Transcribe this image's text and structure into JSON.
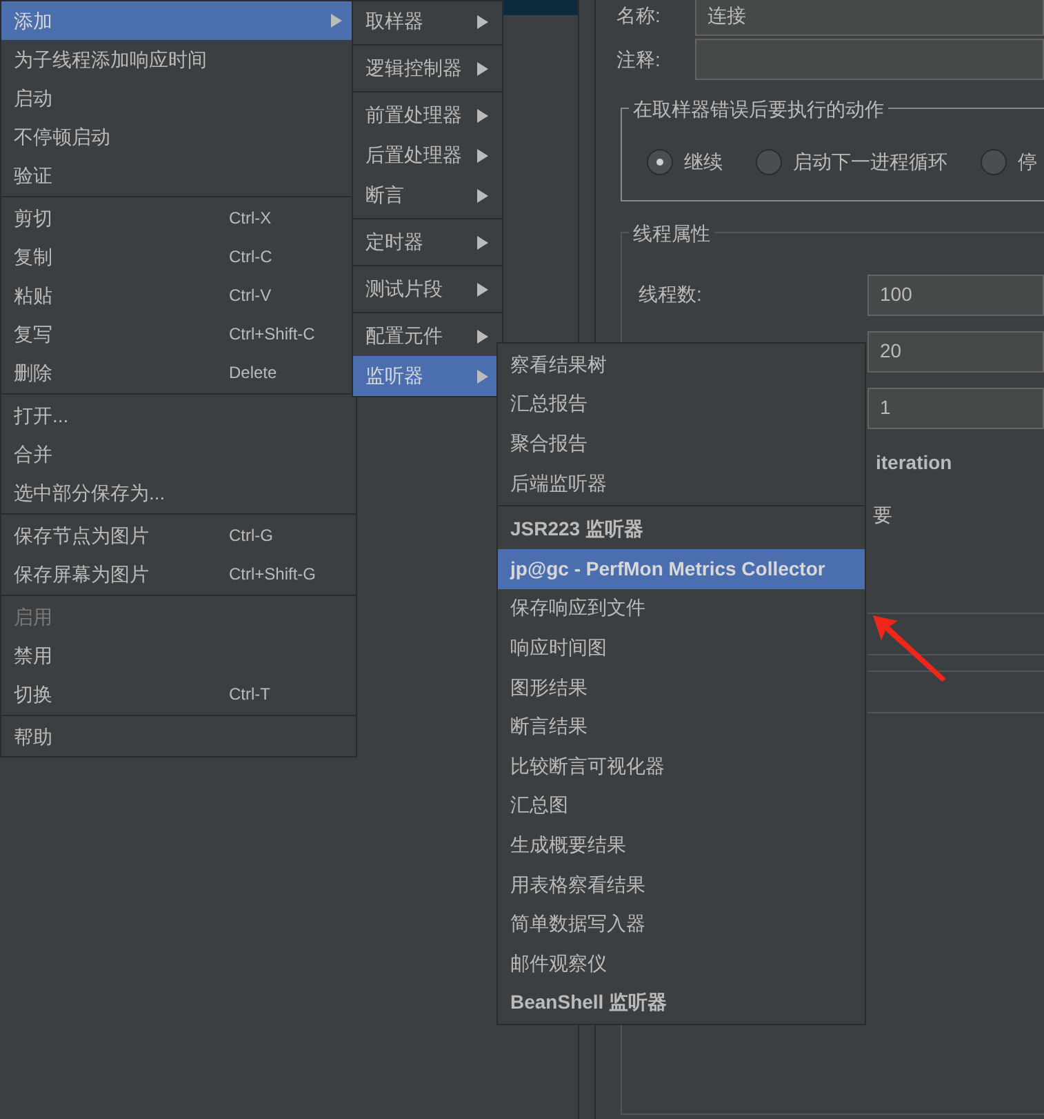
{
  "form": {
    "name_label": "名称:",
    "name_value": "连接",
    "comment_label": "注释:",
    "error_group": {
      "title": "在取样器错误后要执行的动作",
      "options": [
        {
          "label": "继续",
          "selected": true
        },
        {
          "label": "启动下一进程循环",
          "selected": false
        },
        {
          "label": "停",
          "selected": false
        }
      ]
    },
    "thread_group": {
      "title": "线程属性",
      "threads_label": "线程数:",
      "threads_value": "100",
      "rampup_value": "20",
      "loop_value": "1",
      "iteration_text": "iteration",
      "partial_text": "要"
    }
  },
  "context_menu": [
    {
      "kind": "header",
      "label": "添加",
      "selected": true
    },
    {
      "kind": "item",
      "label": "为子线程添加响应时间"
    },
    {
      "kind": "item",
      "label": "启动"
    },
    {
      "kind": "item",
      "label": "不停顿启动"
    },
    {
      "kind": "item",
      "label": "验证"
    },
    {
      "kind": "separator"
    },
    {
      "kind": "item",
      "label": "剪切",
      "shortcut": "Ctrl-X"
    },
    {
      "kind": "item",
      "label": "复制",
      "shortcut": "Ctrl-C"
    },
    {
      "kind": "item",
      "label": "粘贴",
      "shortcut": "Ctrl-V"
    },
    {
      "kind": "item",
      "label": "复写",
      "shortcut": "Ctrl+Shift-C"
    },
    {
      "kind": "item",
      "label": "删除",
      "shortcut": "Delete"
    },
    {
      "kind": "separator"
    },
    {
      "kind": "item",
      "label": "打开..."
    },
    {
      "kind": "item",
      "label": "合并"
    },
    {
      "kind": "item",
      "label": "选中部分保存为..."
    },
    {
      "kind": "separator"
    },
    {
      "kind": "item",
      "label": "保存节点为图片",
      "shortcut": "Ctrl-G"
    },
    {
      "kind": "item",
      "label": "保存屏幕为图片",
      "shortcut": "Ctrl+Shift-G"
    },
    {
      "kind": "separator"
    },
    {
      "kind": "item",
      "label": "启用",
      "disabled": true
    },
    {
      "kind": "item",
      "label": "禁用"
    },
    {
      "kind": "item",
      "label": "切换",
      "shortcut": "Ctrl-T"
    },
    {
      "kind": "separator"
    },
    {
      "kind": "item",
      "label": "帮助"
    }
  ],
  "add_submenu": [
    {
      "kind": "item",
      "label": "取样器",
      "selected": false
    },
    {
      "kind": "separator"
    },
    {
      "kind": "item",
      "label": "逻辑控制器",
      "selected": false
    },
    {
      "kind": "separator"
    },
    {
      "kind": "item",
      "label": "前置处理器",
      "selected": false
    },
    {
      "kind": "item",
      "label": "后置处理器",
      "selected": false
    },
    {
      "kind": "item",
      "label": "断言",
      "selected": false
    },
    {
      "kind": "separator"
    },
    {
      "kind": "item",
      "label": "定时器",
      "selected": false
    },
    {
      "kind": "separator"
    },
    {
      "kind": "item",
      "label": "测试片段",
      "selected": false
    },
    {
      "kind": "separator"
    },
    {
      "kind": "item",
      "label": "配置元件",
      "selected": false
    },
    {
      "kind": "item",
      "label": "监听器",
      "selected": true
    }
  ],
  "listener_submenu": [
    {
      "kind": "item",
      "label": "察看结果树",
      "selected": false
    },
    {
      "kind": "item",
      "label": "汇总报告",
      "selected": false
    },
    {
      "kind": "item",
      "label": "聚合报告",
      "selected": false
    },
    {
      "kind": "item",
      "label": "后端监听器",
      "selected": false
    },
    {
      "kind": "separator"
    },
    {
      "kind": "item",
      "label": "JSR223 监听器",
      "selected": false,
      "bold": true
    },
    {
      "kind": "item",
      "label": "jp@gc - PerfMon Metrics Collector",
      "selected": true,
      "bold": true
    },
    {
      "kind": "item",
      "label": "保存响应到文件",
      "selected": false
    },
    {
      "kind": "item",
      "label": "响应时间图",
      "selected": false
    },
    {
      "kind": "item",
      "label": "图形结果",
      "selected": false
    },
    {
      "kind": "item",
      "label": "断言结果",
      "selected": false
    },
    {
      "kind": "item",
      "label": "比较断言可视化器",
      "selected": false
    },
    {
      "kind": "item",
      "label": "汇总图",
      "selected": false
    },
    {
      "kind": "item",
      "label": "生成概要结果",
      "selected": false
    },
    {
      "kind": "item",
      "label": "用表格察看结果",
      "selected": false
    },
    {
      "kind": "item",
      "label": "简单数据写入器",
      "selected": false
    },
    {
      "kind": "item",
      "label": "邮件观察仪",
      "selected": false
    },
    {
      "kind": "item",
      "label": "BeanShell 监听器",
      "selected": false,
      "bold": true
    }
  ]
}
